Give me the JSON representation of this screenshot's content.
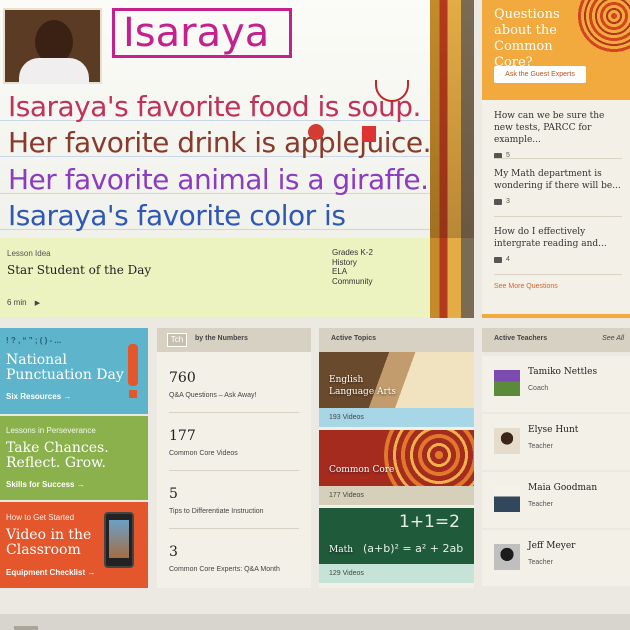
{
  "hero": {
    "name_sign": "Isaraya",
    "sentences": [
      "Isaraya's favorite food is soup.",
      "Her favorite drink is applejuice.",
      "Her favorite animal is a giraffe.",
      "Isaraya's favorite color is"
    ],
    "kicker": "Lesson Idea",
    "title": "Star Student of the Day",
    "duration": "6 min",
    "tags": [
      "Grades K-2",
      "History",
      "ELA",
      "Community"
    ]
  },
  "experts": {
    "heading": "Questions about the Common Core?",
    "button": "Ask the Guest Experts",
    "questions": [
      {
        "text": "How can we be sure the new tests, PARCC for example...",
        "count": "5"
      },
      {
        "text": "My Math department is wondering if there will be...",
        "count": "3"
      },
      {
        "text": "How do I effectively intergrate reading and...",
        "count": "4"
      }
    ],
    "see_more": "See More Questions"
  },
  "tiles": [
    {
      "small": "! ? , “ ” ; ( ) - ...",
      "big": "National Punctuation Day",
      "link": "Six Resources"
    },
    {
      "small": "Lessons in Perseverance",
      "big": "Take Chances. Reflect. Grow.",
      "link": "Skills for Success"
    },
    {
      "small": "How to Get Started",
      "big": "Video in the Classroom",
      "link": "Equipment Checklist"
    }
  ],
  "numbers": {
    "badge": "Tch",
    "label": "by the Numbers",
    "stats": [
      {
        "n": "760",
        "d": "Q&A Questions – Ask Away!"
      },
      {
        "n": "177",
        "d": "Common Core Videos"
      },
      {
        "n": "5",
        "d": "Tips to Differentiate Instruction"
      },
      {
        "n": "3",
        "d": "Common Core Experts: Q&A Month"
      }
    ]
  },
  "topics": {
    "label": "Active Topics",
    "items": [
      {
        "title": "English Language Arts",
        "count": "193 Videos"
      },
      {
        "title": "Common Core",
        "count": "177 Videos"
      },
      {
        "title": "Math",
        "count": "129 Videos"
      }
    ],
    "chalk": [
      "1+1=2",
      "(a+b)² = a² + 2ab"
    ]
  },
  "teachers": {
    "label": "Active Teachers",
    "see_all": "See All",
    "items": [
      {
        "name": "Tamiko Nettles",
        "role": "Coach"
      },
      {
        "name": "Elyse Hunt",
        "role": "Teacher"
      },
      {
        "name": "Maia Goodman",
        "role": "Teacher"
      },
      {
        "name": "Jeff Meyer",
        "role": "Teacher"
      }
    ]
  },
  "colors": {
    "orange": "#f2a93d",
    "blue_tile": "#5db4cb",
    "green_tile": "#8bb14c",
    "red_tile": "#e4562c",
    "caption_bg": "#edf2c1"
  }
}
